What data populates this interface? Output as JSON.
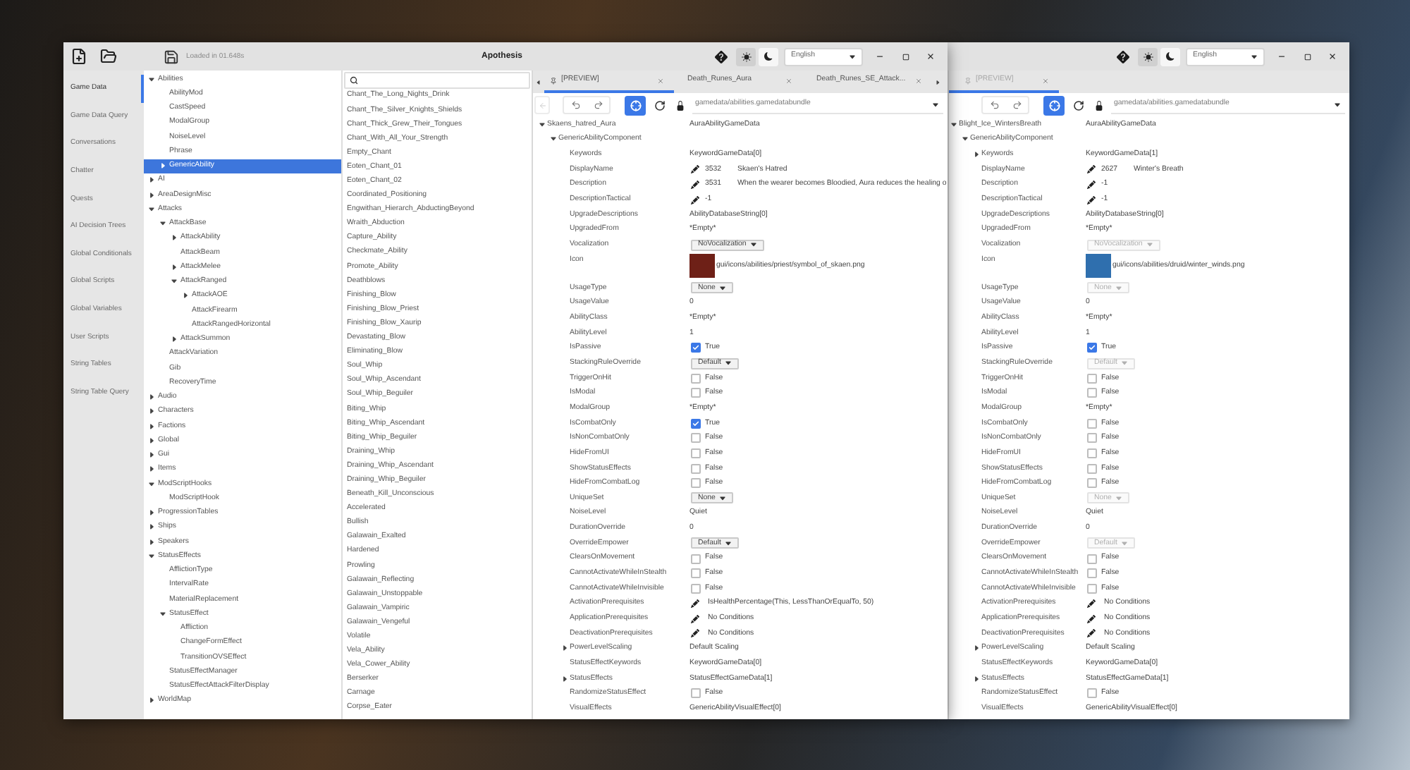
{
  "main_window": {
    "focused": true,
    "title_bar": {
      "status": "Loaded in 01.648s",
      "title": "Apothesis",
      "themes": [
        {
          "kind": "light",
          "selected": true
        },
        {
          "kind": "dark",
          "selected": false
        }
      ],
      "language": "English"
    },
    "nav": [
      {
        "label": "Game Data",
        "selected": true
      },
      {
        "label": "Game Data Query",
        "selected": false
      },
      {
        "label": "Conversations",
        "selected": false
      },
      {
        "label": "Chatter",
        "selected": false
      },
      {
        "label": "Quests",
        "selected": false
      },
      {
        "label": "AI Decision Trees",
        "selected": false
      },
      {
        "label": "Global Conditionals",
        "selected": false
      },
      {
        "label": "Global Scripts",
        "selected": false
      },
      {
        "label": "Global Variables",
        "selected": false
      },
      {
        "label": "User Scripts",
        "selected": false
      },
      {
        "label": "String Tables",
        "selected": false
      },
      {
        "label": "String Table Query",
        "selected": false
      }
    ],
    "tree": [
      {
        "label": "Abilities",
        "expanded": true,
        "selected": false,
        "children": [
          {
            "label": "AbilityMod",
            "selected": false
          },
          {
            "label": "CastSpeed",
            "selected": false
          },
          {
            "label": "ModalGroup",
            "selected": false
          },
          {
            "label": "NoiseLevel",
            "selected": false
          },
          {
            "label": "Phrase",
            "selected": false
          },
          {
            "label": "GenericAbility",
            "expanded": false,
            "selected": true
          }
        ]
      },
      {
        "label": "AI",
        "expanded": false,
        "selected": false
      },
      {
        "label": "AreaDesignMisc",
        "expanded": false,
        "selected": false
      },
      {
        "label": "Attacks",
        "expanded": true,
        "selected": false,
        "children": [
          {
            "label": "AttackBase",
            "expanded": true,
            "selected": false,
            "children": [
              {
                "label": "AttackAbility",
                "expanded": false,
                "selected": false
              },
              {
                "label": "AttackBeam",
                "selected": false
              },
              {
                "label": "AttackMelee",
                "expanded": false,
                "selected": false
              },
              {
                "label": "AttackRanged",
                "expanded": true,
                "selected": false,
                "children": [
                  {
                    "label": "AttackAOE",
                    "expanded": false,
                    "selected": false
                  },
                  {
                    "label": "AttackFirearm",
                    "selected": false
                  },
                  {
                    "label": "AttackRangedHorizontal",
                    "selected": false
                  }
                ]
              },
              {
                "label": "AttackSummon",
                "expanded": false,
                "selected": false
              }
            ]
          },
          {
            "label": "AttackVariation",
            "selected": false
          },
          {
            "label": "Gib",
            "selected": false
          },
          {
            "label": "RecoveryTime",
            "selected": false
          }
        ]
      },
      {
        "label": "Audio",
        "expanded": false,
        "selected": false
      },
      {
        "label": "Characters",
        "expanded": false,
        "selected": false
      },
      {
        "label": "Factions",
        "expanded": false,
        "selected": false
      },
      {
        "label": "Global",
        "expanded": false,
        "selected": false
      },
      {
        "label": "Gui",
        "expanded": false,
        "selected": false
      },
      {
        "label": "Items",
        "expanded": false,
        "selected": false
      },
      {
        "label": "ModScriptHooks",
        "expanded": true,
        "selected": false,
        "children": [
          {
            "label": "ModScriptHook",
            "selected": false
          }
        ]
      },
      {
        "label": "ProgressionTables",
        "expanded": false,
        "selected": false
      },
      {
        "label": "Ships",
        "expanded": false,
        "selected": false
      },
      {
        "label": "Speakers",
        "expanded": false,
        "selected": false
      },
      {
        "label": "StatusEffects",
        "expanded": true,
        "selected": false,
        "children": [
          {
            "label": "AfflictionType",
            "selected": false
          },
          {
            "label": "IntervalRate",
            "selected": false
          },
          {
            "label": "MaterialReplacement",
            "selected": false
          },
          {
            "label": "StatusEffect",
            "expanded": true,
            "selected": false,
            "children": [
              {
                "label": "Affliction",
                "selected": false
              },
              {
                "label": "ChangeFormEffect",
                "selected": false
              },
              {
                "label": "TransitionOVSEffect",
                "selected": false
              }
            ]
          },
          {
            "label": "StatusEffectManager",
            "selected": false
          },
          {
            "label": "StatusEffectAttackFilterDisplay",
            "selected": false
          }
        ]
      },
      {
        "label": "WorldMap",
        "expanded": false,
        "selected": false
      }
    ],
    "list": {
      "items": [
        "Chant_The_Long_Nights_Drink",
        "Chant_The_Silver_Knights_Shields",
        "Chant_Thick_Grew_Their_Tongues",
        "Chant_With_All_Your_Strength",
        "Empty_Chant",
        "Eoten_Chant_01",
        "Eoten_Chant_02",
        "Coordinated_Positioning",
        "Engwithan_Hierarch_AbductingBeyond",
        "Wraith_Abduction",
        "Capture_Ability",
        "Checkmate_Ability",
        "Promote_Ability",
        "Deathblows",
        "Finishing_Blow",
        "Finishing_Blow_Priest",
        "Finishing_Blow_Xaurip",
        "Devastating_Blow",
        "Eliminating_Blow",
        "Soul_Whip",
        "Soul_Whip_Ascendant",
        "Soul_Whip_Beguiler",
        "Biting_Whip",
        "Biting_Whip_Ascendant",
        "Biting_Whip_Beguiler",
        "Draining_Whip",
        "Draining_Whip_Ascendant",
        "Draining_Whip_Beguiler",
        "Beneath_Kill_Unconscious",
        "Accelerated",
        "Bullish",
        "Galawain_Exalted",
        "Hardened",
        "Prowling",
        "Galawain_Reflecting",
        "Galawain_Unstoppable",
        "Galawain_Vampiric",
        "Galawain_Vengeful",
        "Volatile",
        "Vela_Ability",
        "Vela_Cower_Ability",
        "Berserker",
        "Carnage",
        "Corpse_Eater"
      ]
    },
    "editor": {
      "tabs_overflow": true,
      "tabs": [
        {
          "label": "[PREVIEW]",
          "pinned": true,
          "selected": true
        },
        {
          "label": "Death_Runes_Aura",
          "pinned": false,
          "selected": false
        },
        {
          "label": "Death_Runes_SE_Attack...",
          "pinned": false,
          "selected": false
        }
      ],
      "path": "gamedata/abilities.gamedatabundle",
      "grid": [
        {
          "label": "Skaens_hatred_Aura",
          "kind": "text",
          "value": "AuraAbilityGameData",
          "expanded": true,
          "children": [
            {
              "label": "GenericAbilityComponent",
              "expanded": true,
              "children": [
                {
                  "label": "Keywords",
                  "kind": "text",
                  "value": "KeywordGameData[0]"
                },
                {
                  "label": "DisplayName",
                  "kind": "ref",
                  "id": "3532",
                  "text": "Skaen's Hatred"
                },
                {
                  "label": "Description",
                  "kind": "ref",
                  "id": "3531",
                  "text": "When the wearer becomes Bloodied, Aura reduces the healing o"
                },
                {
                  "label": "DescriptionTactical",
                  "kind": "ref",
                  "id": "-1"
                },
                {
                  "label": "UpgradeDescriptions",
                  "kind": "text",
                  "value": "AbilityDatabaseString[0]"
                },
                {
                  "label": "UpgradedFrom",
                  "kind": "text",
                  "value": "*Empty*"
                },
                {
                  "label": "Vocalization",
                  "kind": "dropdown",
                  "value": "NoVocalization",
                  "disabled": false
                },
                {
                  "label": "Icon",
                  "kind": "image",
                  "color": "#6e2017",
                  "value": "gui/icons/abilities/priest/symbol_of_skaen.png"
                },
                {
                  "label": "UsageType",
                  "kind": "dropdown",
                  "value": "None",
                  "disabled": false
                },
                {
                  "label": "UsageValue",
                  "kind": "text",
                  "value": "0"
                },
                {
                  "label": "AbilityClass",
                  "kind": "text",
                  "value": "*Empty*"
                },
                {
                  "label": "AbilityLevel",
                  "kind": "text",
                  "value": "1"
                },
                {
                  "label": "IsPassive",
                  "kind": "checkbox",
                  "checked": true,
                  "value": "True"
                },
                {
                  "label": "StackingRuleOverride",
                  "kind": "dropdown",
                  "value": "Default",
                  "disabled": false
                },
                {
                  "label": "TriggerOnHit",
                  "kind": "checkbox",
                  "checked": false,
                  "value": "False"
                },
                {
                  "label": "IsModal",
                  "kind": "checkbox",
                  "checked": false,
                  "value": "False"
                },
                {
                  "label": "ModalGroup",
                  "kind": "text",
                  "value": "*Empty*"
                },
                {
                  "label": "IsCombatOnly",
                  "kind": "checkbox",
                  "checked": true,
                  "value": "True"
                },
                {
                  "label": "IsNonCombatOnly",
                  "kind": "checkbox",
                  "checked": false,
                  "value": "False"
                },
                {
                  "label": "HideFromUI",
                  "kind": "checkbox",
                  "checked": false,
                  "value": "False"
                },
                {
                  "label": "ShowStatusEffects",
                  "kind": "checkbox",
                  "checked": false,
                  "value": "False"
                },
                {
                  "label": "HideFromCombatLog",
                  "kind": "checkbox",
                  "checked": false,
                  "value": "False"
                },
                {
                  "label": "UniqueSet",
                  "kind": "dropdown",
                  "value": "None",
                  "disabled": false
                },
                {
                  "label": "NoiseLevel",
                  "kind": "text",
                  "value": "Quiet"
                },
                {
                  "label": "DurationOverride",
                  "kind": "text",
                  "value": "0"
                },
                {
                  "label": "OverrideEmpower",
                  "kind": "dropdown",
                  "value": "Default",
                  "disabled": false
                },
                {
                  "label": "ClearsOnMovement",
                  "kind": "checkbox",
                  "checked": false,
                  "value": "False"
                },
                {
                  "label": "CannotActivateWhileInStealth",
                  "kind": "checkbox",
                  "checked": false,
                  "value": "False"
                },
                {
                  "label": "CannotActivateWhileInvisible",
                  "kind": "checkbox",
                  "checked": false,
                  "value": "False"
                },
                {
                  "label": "ActivationPrerequisites",
                  "kind": "conditions",
                  "value": "IsHealthPercentage(This, LessThanOrEqualTo, 50)"
                },
                {
                  "label": "ApplicationPrerequisites",
                  "kind": "conditions",
                  "value": "No Conditions"
                },
                {
                  "label": "DeactivationPrerequisites",
                  "kind": "conditions",
                  "value": "No Conditions"
                },
                {
                  "label": "PowerLevelScaling",
                  "kind": "text",
                  "value": "Default Scaling",
                  "expanded": false
                },
                {
                  "label": "StatusEffectKeywords",
                  "kind": "text",
                  "value": "KeywordGameData[0]"
                },
                {
                  "label": "StatusEffects",
                  "kind": "text",
                  "value": "StatusEffectGameData[1]",
                  "expanded": false
                },
                {
                  "label": "RandomizeStatusEffect",
                  "kind": "checkbox",
                  "checked": false,
                  "value": "False"
                },
                {
                  "label": "VisualEffects",
                  "kind": "text",
                  "value": "GenericAbilityVisualEffect[0]"
                }
              ]
            }
          ]
        }
      ]
    }
  },
  "second_window": {
    "focused": false,
    "title_bar": {
      "themes": [
        {
          "kind": "light",
          "selected": true
        },
        {
          "kind": "dark",
          "selected": false
        }
      ],
      "language": "English"
    },
    "editor": {
      "tabs_overflow": false,
      "tabs": [
        {
          "label": "[PREVIEW]",
          "pinned": true,
          "selected": true
        }
      ],
      "path": "gamedata/abilities.gamedatabundle",
      "grid": [
        {
          "label": "Blight_Ice_WintersBreath",
          "kind": "text",
          "value": "AuraAbilityGameData",
          "expanded": true,
          "children": [
            {
              "label": "GenericAbilityComponent",
              "expanded": true,
              "children": [
                {
                  "label": "Keywords",
                  "kind": "text",
                  "value": "KeywordGameData[1]",
                  "expanded": false
                },
                {
                  "label": "DisplayName",
                  "kind": "ref",
                  "id": "2627",
                  "text": "Winter's Breath"
                },
                {
                  "label": "Description",
                  "kind": "ref",
                  "id": "-1"
                },
                {
                  "label": "DescriptionTactical",
                  "kind": "ref",
                  "id": "-1"
                },
                {
                  "label": "UpgradeDescriptions",
                  "kind": "text",
                  "value": "AbilityDatabaseString[0]"
                },
                {
                  "label": "UpgradedFrom",
                  "kind": "text",
                  "value": "*Empty*"
                },
                {
                  "label": "Vocalization",
                  "kind": "dropdown",
                  "value": "NoVocalization",
                  "disabled": true
                },
                {
                  "label": "Icon",
                  "kind": "image",
                  "color": "#2f6fae",
                  "value": "gui/icons/abilities/druid/winter_winds.png"
                },
                {
                  "label": "UsageType",
                  "kind": "dropdown",
                  "value": "None",
                  "disabled": true
                },
                {
                  "label": "UsageValue",
                  "kind": "text",
                  "value": "0"
                },
                {
                  "label": "AbilityClass",
                  "kind": "text",
                  "value": "*Empty*"
                },
                {
                  "label": "AbilityLevel",
                  "kind": "text",
                  "value": "1"
                },
                {
                  "label": "IsPassive",
                  "kind": "checkbox",
                  "checked": true,
                  "value": "True"
                },
                {
                  "label": "StackingRuleOverride",
                  "kind": "dropdown",
                  "value": "Default",
                  "disabled": true
                },
                {
                  "label": "TriggerOnHit",
                  "kind": "checkbox",
                  "checked": false,
                  "value": "False"
                },
                {
                  "label": "IsModal",
                  "kind": "checkbox",
                  "checked": false,
                  "value": "False"
                },
                {
                  "label": "ModalGroup",
                  "kind": "text",
                  "value": "*Empty*"
                },
                {
                  "label": "IsCombatOnly",
                  "kind": "checkbox",
                  "checked": false,
                  "value": "False"
                },
                {
                  "label": "IsNonCombatOnly",
                  "kind": "checkbox",
                  "checked": false,
                  "value": "False"
                },
                {
                  "label": "HideFromUI",
                  "kind": "checkbox",
                  "checked": false,
                  "value": "False"
                },
                {
                  "label": "ShowStatusEffects",
                  "kind": "checkbox",
                  "checked": false,
                  "value": "False"
                },
                {
                  "label": "HideFromCombatLog",
                  "kind": "checkbox",
                  "checked": false,
                  "value": "False"
                },
                {
                  "label": "UniqueSet",
                  "kind": "dropdown",
                  "value": "None",
                  "disabled": true
                },
                {
                  "label": "NoiseLevel",
                  "kind": "text",
                  "value": "Quiet"
                },
                {
                  "label": "DurationOverride",
                  "kind": "text",
                  "value": "0"
                },
                {
                  "label": "OverrideEmpower",
                  "kind": "dropdown",
                  "value": "Default",
                  "disabled": true
                },
                {
                  "label": "ClearsOnMovement",
                  "kind": "checkbox",
                  "checked": false,
                  "value": "False"
                },
                {
                  "label": "CannotActivateWhileInStealth",
                  "kind": "checkbox",
                  "checked": false,
                  "value": "False"
                },
                {
                  "label": "CannotActivateWhileInvisible",
                  "kind": "checkbox",
                  "checked": false,
                  "value": "False"
                },
                {
                  "label": "ActivationPrerequisites",
                  "kind": "conditions",
                  "value": "No Conditions"
                },
                {
                  "label": "ApplicationPrerequisites",
                  "kind": "conditions",
                  "value": "No Conditions"
                },
                {
                  "label": "DeactivationPrerequisites",
                  "kind": "conditions",
                  "value": "No Conditions"
                },
                {
                  "label": "PowerLevelScaling",
                  "kind": "text",
                  "value": "Default Scaling",
                  "expanded": false
                },
                {
                  "label": "StatusEffectKeywords",
                  "kind": "text",
                  "value": "KeywordGameData[0]"
                },
                {
                  "label": "StatusEffects",
                  "kind": "text",
                  "value": "StatusEffectGameData[1]",
                  "expanded": false
                },
                {
                  "label": "RandomizeStatusEffect",
                  "kind": "checkbox",
                  "checked": false,
                  "value": "False"
                },
                {
                  "label": "VisualEffects",
                  "kind": "text",
                  "value": "GenericAbilityVisualEffect[0]"
                }
              ]
            }
          ]
        }
      ]
    }
  }
}
